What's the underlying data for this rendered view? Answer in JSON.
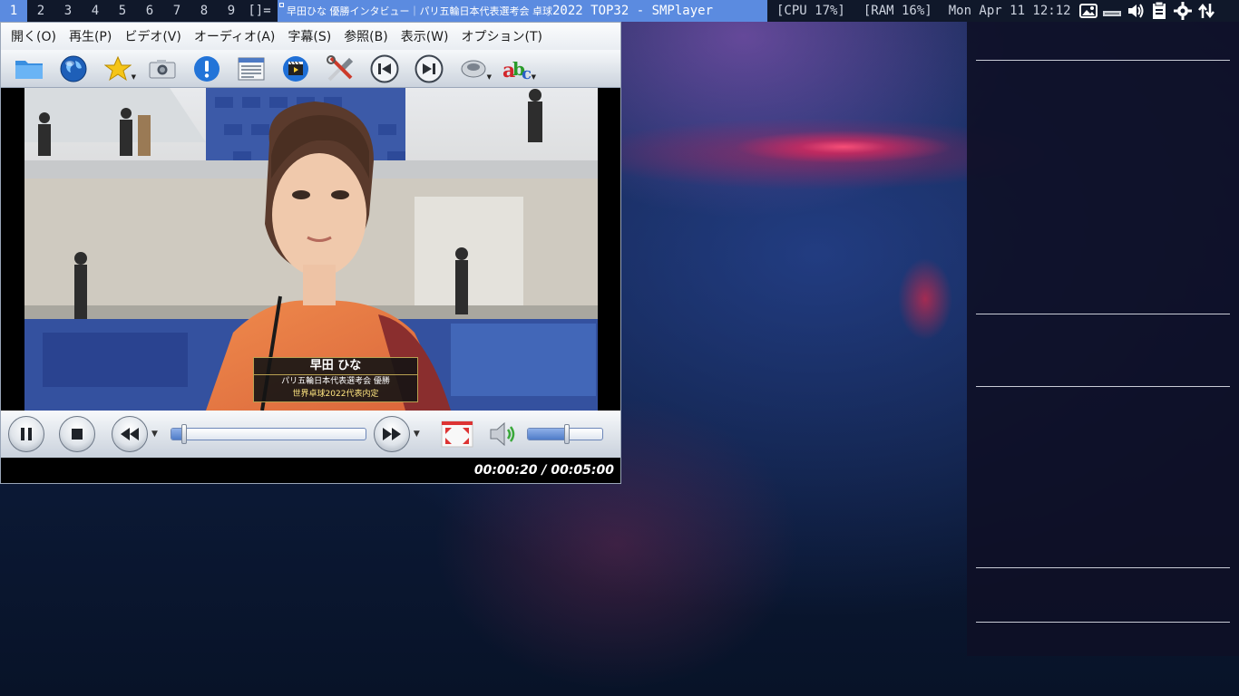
{
  "topbar": {
    "workspaces": [
      "1",
      "2",
      "3",
      "4",
      "5",
      "6",
      "7",
      "8",
      "9"
    ],
    "active_workspace": "1",
    "layout_symbol": "[]=",
    "window_title_jp": "早田ひな 優勝インタビュー｜パリ五輪日本代表選考会 卓球",
    "window_title_rest": "2022 TOP32 - SMPlayer",
    "cpu": "[CPU 17%]",
    "ram": "[RAM 16%]",
    "clock": "Mon Apr 11 12:12"
  },
  "player": {
    "menu": [
      "開く(O)",
      "再生(P)",
      "ビデオ(V)",
      "オーディオ(A)",
      "字幕(S)",
      "参照(B)",
      "表示(W)",
      "オプション(T)"
    ],
    "toolbar_icons": [
      "folder-icon",
      "globe-icon",
      "favorites-star-icon",
      "screenshot-camera-icon",
      "info-icon",
      "playlist-icon",
      "video-clapper-icon",
      "preferences-tools-icon",
      "previous-icon",
      "next-icon",
      "audio-track-icon",
      "subtitles-icon"
    ],
    "caption": {
      "name": "早田 ひな",
      "line2": "パリ五輪日本代表選考会 優勝",
      "line3": "世界卓球2022代表内定"
    },
    "seek_progress": 0.0667,
    "volume_level": 0.52,
    "time_display": "00:00:20 / 00:05:00"
  },
  "colors": {
    "accent": "#5b8be0",
    "topbar_bg": "#10182a"
  }
}
